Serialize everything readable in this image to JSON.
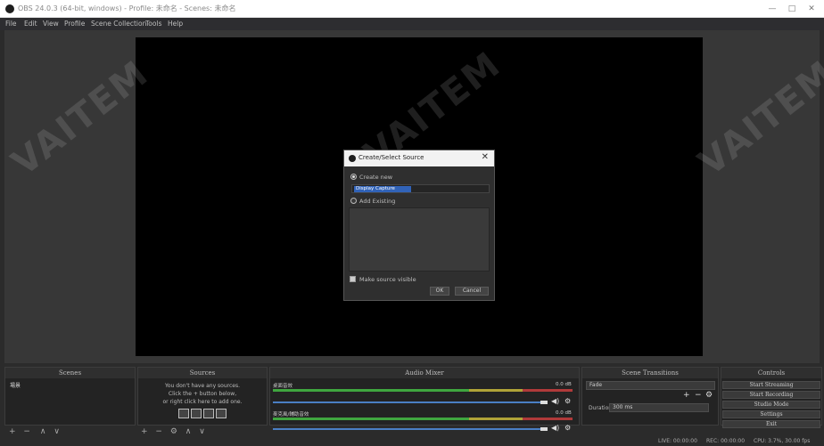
{
  "window": {
    "title": "OBS 24.0.3 (64-bit, windows) - Profile: 未命名 - Scenes: 未命名",
    "minimize": "—",
    "maximize": "□",
    "close": "✕"
  },
  "menu": [
    "File",
    "Edit",
    "View",
    "Profile",
    "Scene Collection",
    "Tools",
    "Help"
  ],
  "watermark": "VAITEM",
  "dialog": {
    "title": "Create/Select Source",
    "close": "✕",
    "create_new_label": "Create new",
    "new_name_value": "Display Capture",
    "add_existing_label": "Add Existing",
    "make_visible_label": "Make source visible",
    "ok_label": "OK",
    "cancel_label": "Cancel"
  },
  "docks": {
    "scenes": {
      "title": "Scenes",
      "items": [
        "場景"
      ]
    },
    "sources": {
      "title": "Sources",
      "hint_line1": "You don't have any sources.",
      "hint_line2": "Click the + button below,",
      "hint_line3": "or right click here to add one."
    },
    "mixer": {
      "title": "Audio Mixer",
      "channels": [
        {
          "name": "桌面音效",
          "db": "0.0 dB"
        },
        {
          "name": "麥克風/輔助音效",
          "db": "0.0 dB"
        }
      ]
    },
    "transitions": {
      "title": "Scene Transitions",
      "selected": "Fade",
      "duration_label": "Duration",
      "duration_value": "300 ms"
    },
    "controls": {
      "title": "Controls",
      "buttons": [
        "Start Streaming",
        "Start Recording",
        "Studio Mode",
        "Settings",
        "Exit"
      ]
    }
  },
  "toolbar_glyphs": {
    "add": "+",
    "remove": "−",
    "up": "∧",
    "down": "∨",
    "gear": "⚙"
  },
  "status": {
    "live": "LIVE: 00:00:00",
    "rec": "REC: 00:00:00",
    "cpu": "CPU: 3.7%, 30.00 fps"
  }
}
